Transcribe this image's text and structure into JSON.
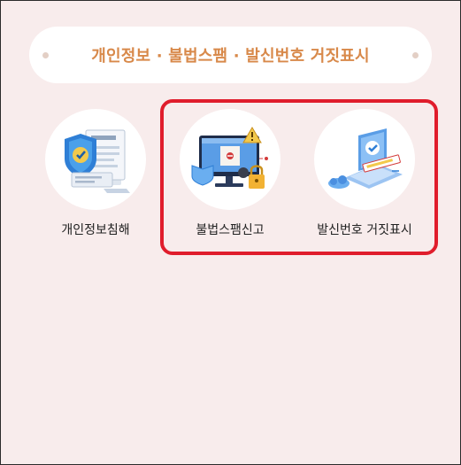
{
  "header": {
    "title": "개인정보 · 불법스팸 · 발신번호 거짓표시"
  },
  "menu": {
    "items": [
      {
        "label": "개인정보침해",
        "icon": "shield-document-icon"
      },
      {
        "label": "불법스팸신고",
        "icon": "monitor-warning-lock-icon"
      },
      {
        "label": "발신번호 거짓표시",
        "icon": "laptop-fake-call-icon"
      }
    ]
  },
  "colors": {
    "background": "#f8ecec",
    "title": "#d8894a",
    "highlight": "#e01d2c"
  }
}
